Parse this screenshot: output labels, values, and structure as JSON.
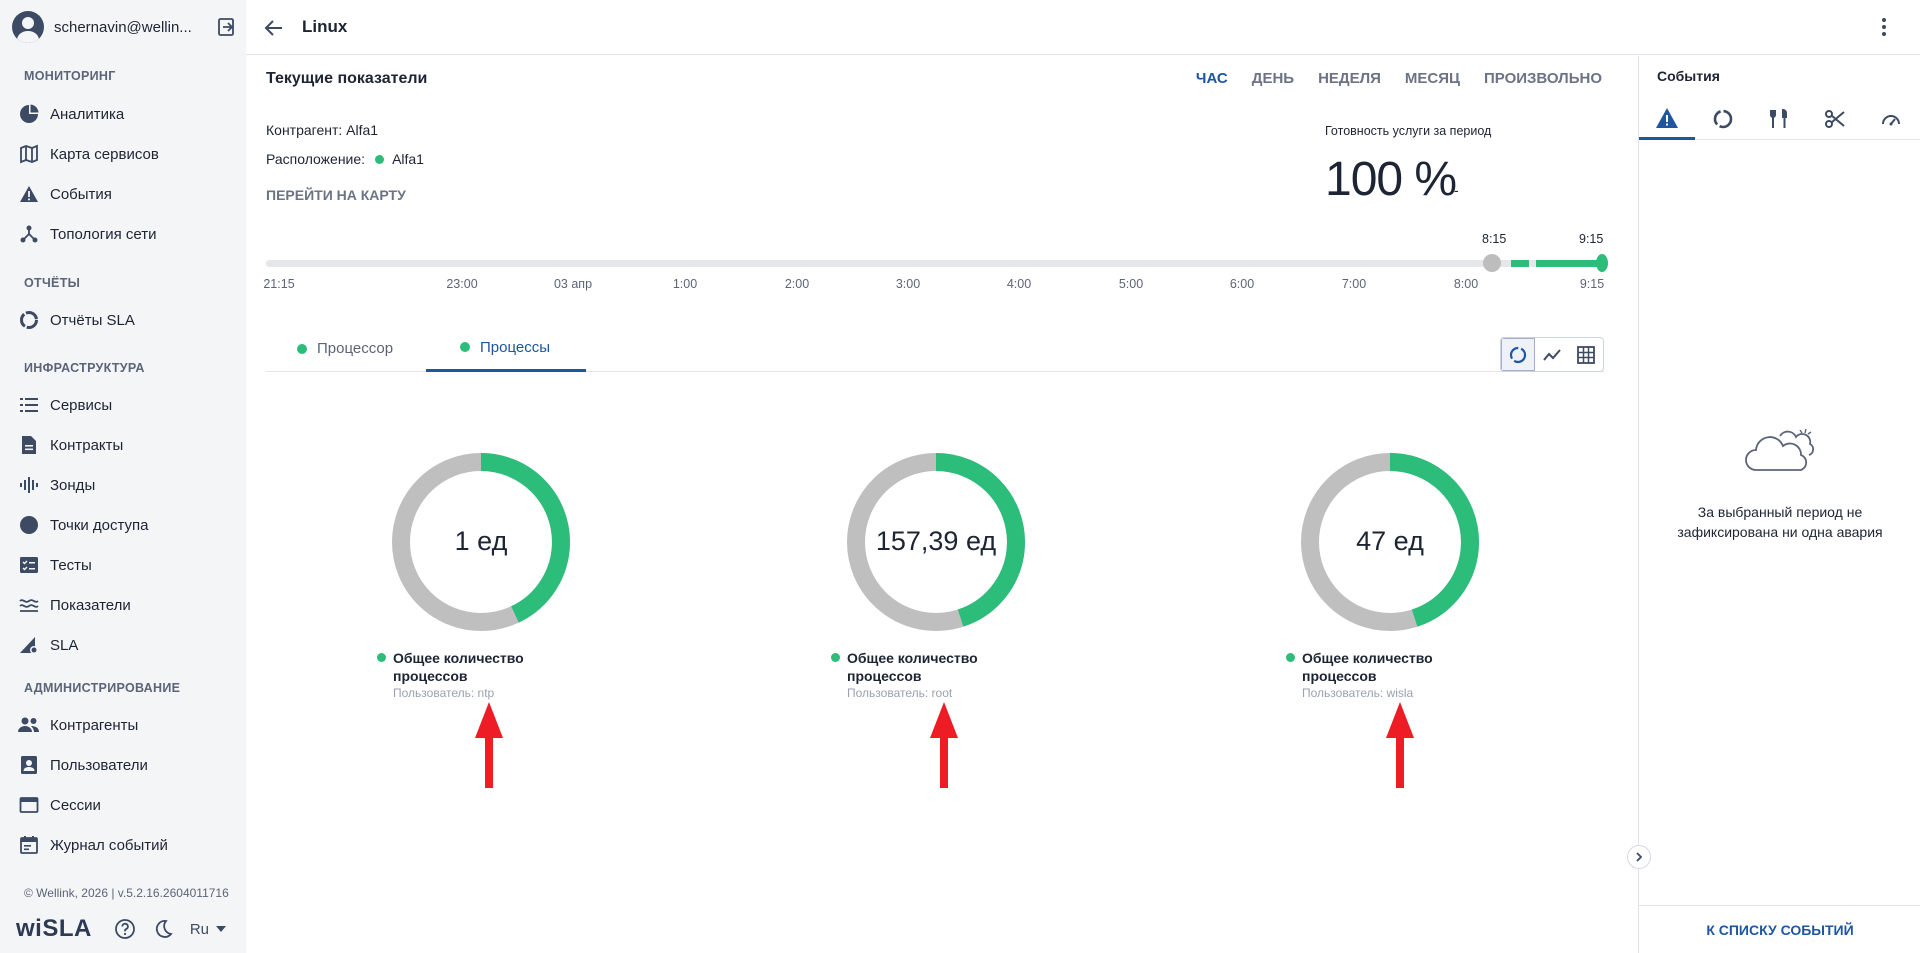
{
  "user": {
    "name": "schernavin@wellin..."
  },
  "nav": {
    "monitoring_title": "МОНИТОРИНГ",
    "monitoring": [
      "Аналитика",
      "Карта сервисов",
      "События",
      "Топология сети"
    ],
    "reports_title": "ОТЧЁТЫ",
    "reports": [
      "Отчёты SLA"
    ],
    "infra_title": "ИНФРАСТРУКТУРА",
    "infra": [
      "Сервисы",
      "Контракты",
      "Зонды",
      "Точки доступа",
      "Тесты",
      "Показатели",
      "SLA"
    ],
    "admin_title": "АДМИНИСТРИРОВАНИЕ",
    "admin": [
      "Контрагенты",
      "Пользователи",
      "Сессии",
      "Журнал событий"
    ]
  },
  "footer": {
    "copyright": "© Wellink, 2026 | v.5.2.16.2604011716",
    "logo": "wiSLA",
    "lang": "Ru"
  },
  "header": {
    "title": "Linux"
  },
  "main": {
    "section_title": "Текущие показатели",
    "periods": [
      "ЧАС",
      "ДЕНЬ",
      "НЕДЕЛЯ",
      "МЕСЯЦ",
      "ПРОИЗВОЛЬНО"
    ],
    "active_period": "ЧАС",
    "counterparty_label": "Контрагент: Alfa1",
    "location_label": "Расположение:",
    "location_value": "Alfa1",
    "map_link": "ПЕРЕЙТИ НА КАРТУ",
    "availability_label": "Готовность услуги за период",
    "availability_value": "100 %",
    "availability_suffix": "-"
  },
  "timeline": {
    "range_start": "8:15",
    "range_end": "9:15",
    "ticks": [
      "21:15",
      "23:00",
      "03 апр",
      "1:00",
      "2:00",
      "3:00",
      "4:00",
      "5:00",
      "6:00",
      "7:00",
      "8:00",
      "9:15"
    ]
  },
  "tabs": [
    {
      "label": "Процессор",
      "active": false
    },
    {
      "label": "Процессы",
      "active": true
    }
  ],
  "gauges": [
    {
      "value": "1 ед",
      "title_line1": "Общее количество",
      "title_line2": "процессов",
      "user": "Пользователь: ntp",
      "fill_fraction": 0.43
    },
    {
      "value": "157,39 ед",
      "title_line1": "Общее количество",
      "title_line2": "процессов",
      "user": "Пользователь: root",
      "fill_fraction": 0.45
    },
    {
      "value": "47 ед",
      "title_line1": "Общее количество",
      "title_line2": "процессов",
      "user": "Пользователь: wisla",
      "fill_fraction": 0.45
    }
  ],
  "events_panel": {
    "title": "События",
    "empty_line1": "За выбранный период не",
    "empty_line2": "зафиксирована ни одна авария",
    "footer_link": "К СПИСКУ СОБЫТИЙ"
  },
  "colors": {
    "accent": "#1e56a0",
    "green": "#2dbd7a",
    "gray_ring": "#bfbfbf",
    "arrow_red": "#ee1c24"
  }
}
